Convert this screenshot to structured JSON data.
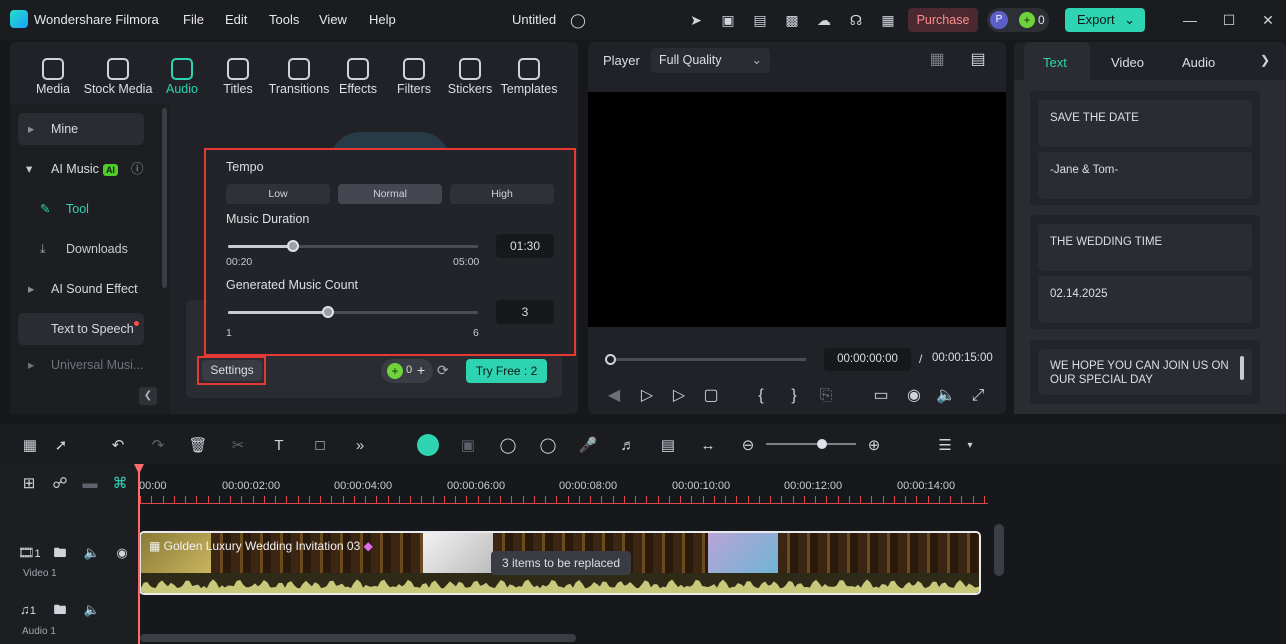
{
  "app": {
    "name": "Wondershare Filmora",
    "doc_title": "Untitled",
    "menu": [
      "File",
      "Edit",
      "Tools",
      "View",
      "Help"
    ],
    "purchase": "Purchase",
    "avatar_letter": "P",
    "credits": "0",
    "export": "Export"
  },
  "media_tabs": [
    {
      "label": "Media",
      "icon": "media-icon"
    },
    {
      "label": "Stock Media",
      "icon": "stock-media-icon"
    },
    {
      "label": "Audio",
      "icon": "audio-icon"
    },
    {
      "label": "Titles",
      "icon": "titles-icon"
    },
    {
      "label": "Transitions",
      "icon": "transitions-icon"
    },
    {
      "label": "Effects",
      "icon": "effects-icon"
    },
    {
      "label": "Filters",
      "icon": "filters-icon"
    },
    {
      "label": "Stickers",
      "icon": "stickers-icon"
    },
    {
      "label": "Templates",
      "icon": "templates-icon"
    }
  ],
  "sidebar": {
    "items": [
      {
        "label": "Mine"
      },
      {
        "label": "AI Music",
        "badge": "AI"
      },
      {
        "label": "Tool"
      },
      {
        "label": "Downloads"
      },
      {
        "label": "AI Sound Effect",
        "badge": "AI"
      },
      {
        "label": "Text to Speech"
      },
      {
        "label": "Universal Musi..."
      }
    ]
  },
  "settings_panel": {
    "tempo_label": "Tempo",
    "tempo_options": [
      "Low",
      "Normal",
      "High"
    ],
    "tempo_selected": "Normal",
    "duration_label": "Music Duration",
    "duration_min": "00:20",
    "duration_max": "05:00",
    "duration_value": "01:30",
    "duration_fraction": 0.26,
    "count_label": "Generated Music Count",
    "count_min": "1",
    "count_max": "6",
    "count_value": "3",
    "count_fraction": 0.4,
    "settings_button": "Settings",
    "credits_count": "0",
    "try_free": "Try Free : 2"
  },
  "player": {
    "label": "Player",
    "quality": "Full Quality",
    "current_time": "00:00:00:00",
    "separator": "/",
    "total_time": "00:00:15:00",
    "progress_fraction": 0.0
  },
  "right_panel": {
    "tabs": [
      "Text",
      "Video",
      "Audio"
    ],
    "active_tab": "Text",
    "cards": [
      [
        "SAVE THE DATE",
        "-Jane & Tom-"
      ],
      [
        "THE WEDDING TIME",
        "02.14.2025"
      ],
      [
        "WE HOPE YOU CAN JOIN US ON OUR SPECIAL DAY"
      ]
    ]
  },
  "timeline": {
    "ruler": [
      "00:00",
      "00:00:02:00",
      "00:00:04:00",
      "00:00:06:00",
      "00:00:08:00",
      "00:00:10:00",
      "00:00:12:00",
      "00:00:14:00"
    ],
    "clip_title": "Golden Luxury Wedding Invitation 03",
    "replace_note": "3 items to be replaced",
    "tracks": [
      {
        "label": "Video 1",
        "num": "1"
      },
      {
        "label": "Audio 1",
        "num": "1"
      }
    ],
    "zoom_fraction": 0.62
  },
  "colors": {
    "accent": "#2ed3b1",
    "highlight": "#e53935",
    "waveform": "#c8c97a"
  }
}
